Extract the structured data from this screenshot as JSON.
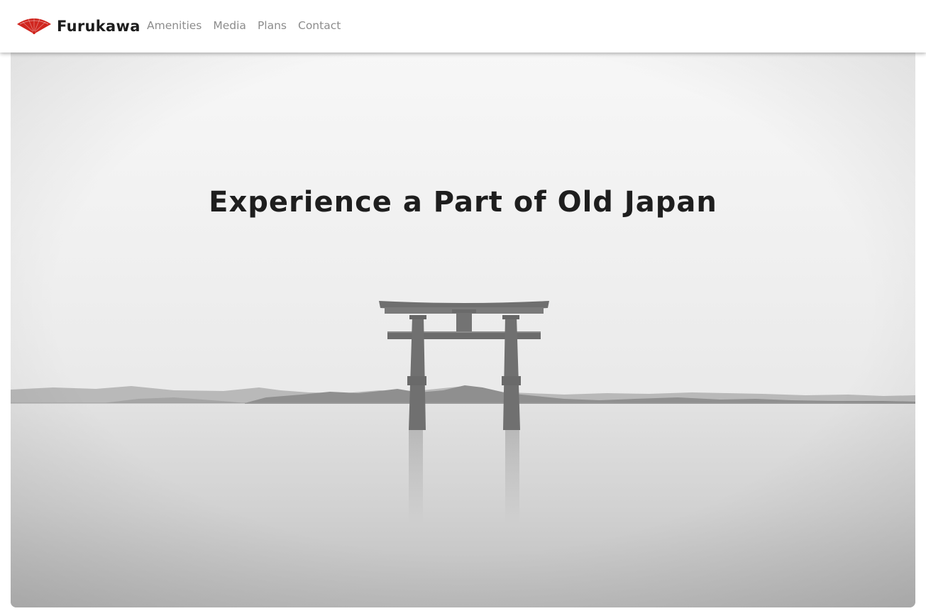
{
  "brand": {
    "name": "Furukawa",
    "logo_icon": "folding-fan-icon",
    "logo_color": "#d0261f"
  },
  "nav": {
    "items": [
      {
        "label": "Amenities"
      },
      {
        "label": "Media"
      },
      {
        "label": "Plans"
      },
      {
        "label": "Contact"
      }
    ]
  },
  "hero": {
    "title": "Experience a Part of Old Japan",
    "image_icon": "torii-gate-lake-photo"
  }
}
